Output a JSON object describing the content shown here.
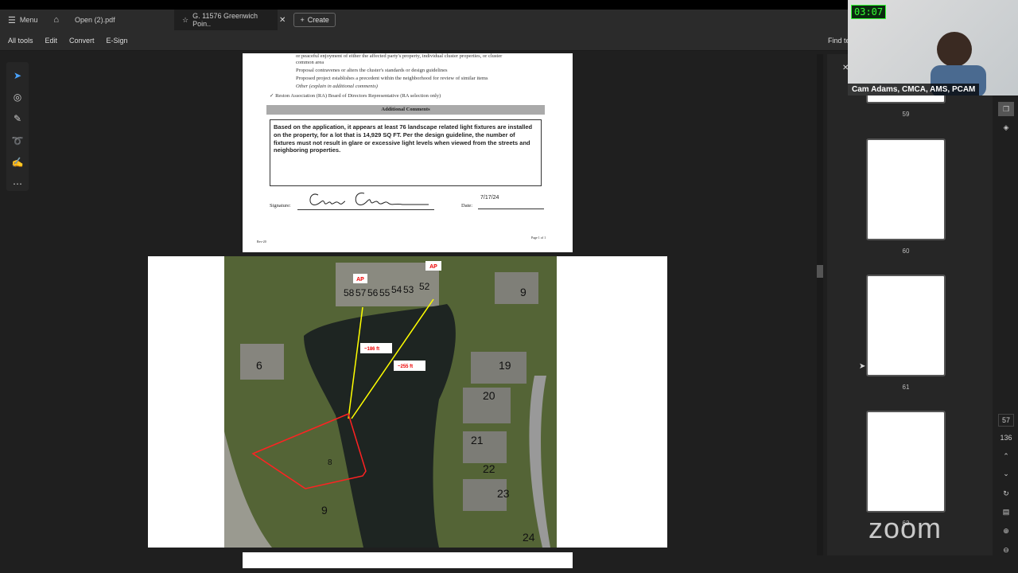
{
  "tabs": {
    "menu": "Menu",
    "open_file": "Open (2).pdf",
    "active_tab": "G. 11576 Greenwich Poin..",
    "create": "Create"
  },
  "menubar": {
    "all_tools": "All tools",
    "edit": "Edit",
    "convert": "Convert",
    "esign": "E-Sign",
    "find": "Find te"
  },
  "doc": {
    "lines": [
      "or peaceful enjoyment of either the affected party's property, individual cluster properties, or cluster",
      "common area",
      "Proposal contravenes or alters the cluster's standards or design guidelines",
      "Proposed project establishes a precedent within the neighborhood for review of similar items",
      "Other (explain in additional comments)"
    ],
    "ra_line": "✓  Reston Association (RA) Board of Directors Representative (RA selection only)",
    "comments_header": "Additional Comments",
    "comment": "Based on the application, it appears at least 76 landscape related light fixtures are installed on the property, for a lot that is 14,929 SQ FT.  Per the design guideline, the number of fixtures must not result in glare or excessive light levels when viewed from the streets and neighboring properties.",
    "signature_label": "Signature:",
    "date_label": "Date:",
    "date": "7/17/24",
    "footer_left": "Rev-20",
    "footer_right": "Page 1 of 1"
  },
  "map": {
    "ap1": "AP",
    "ap2": "AP",
    "dist1": "~186 ft",
    "dist2": "~255 ft",
    "lots": [
      "58",
      "57",
      "56",
      "55",
      "54",
      "53",
      "52",
      "9",
      "6",
      "19",
      "20",
      "21",
      "22",
      "23",
      "24",
      "9",
      "8"
    ]
  },
  "thumbnails": [
    {
      "page": "59"
    },
    {
      "page": "60"
    },
    {
      "page": "61"
    },
    {
      "page": "62"
    }
  ],
  "pager": {
    "current": "57",
    "total": "136"
  },
  "video": {
    "timer": "03:07",
    "name": "Cam Adams, CMCA, AMS, PCAM",
    "logo": "zoom"
  }
}
